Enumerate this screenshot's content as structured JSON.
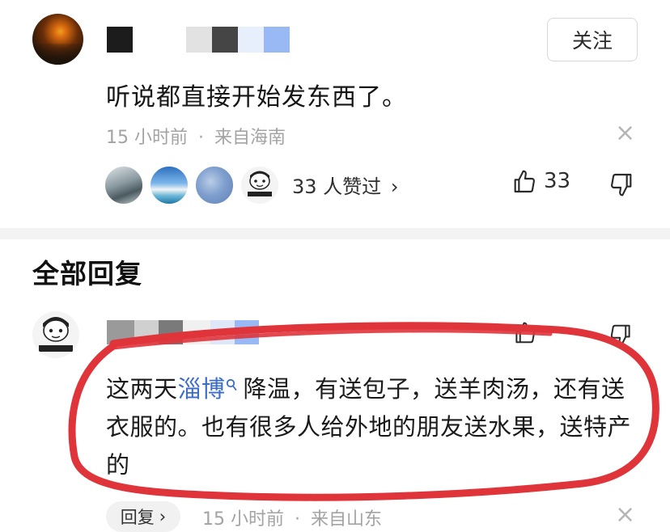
{
  "comment": {
    "username_censor_colors": [
      "#1c1c1c",
      "#ffffff",
      "#ffffff",
      "#e2e2e2",
      "#454545",
      "#e7eefc",
      "#98b9f3"
    ],
    "follow_label": "关注",
    "text": "听说都直接开始发东西了。",
    "time": "15 小时前",
    "separator": "·",
    "location": "来自海南",
    "likers_summary": "33 人赞过",
    "likers_chevron": "›",
    "like_count": "33",
    "close_glyph": "×"
  },
  "replies_section": {
    "title": "全部回复"
  },
  "reply": {
    "text_before_topic": "这两天",
    "topic": "淄博",
    "topic_icon": "search-icon",
    "text_after_topic": "降温，有送包子，送羊肉汤，还有送衣服的。也有很多人给外地的朋友送水果，送特产的",
    "reply_label": "回复",
    "reply_chevron": "›",
    "time": "15 小时前",
    "separator": "·",
    "location": "来自山东",
    "close_glyph": "×"
  },
  "annotation": {
    "color": "#e0343b"
  }
}
